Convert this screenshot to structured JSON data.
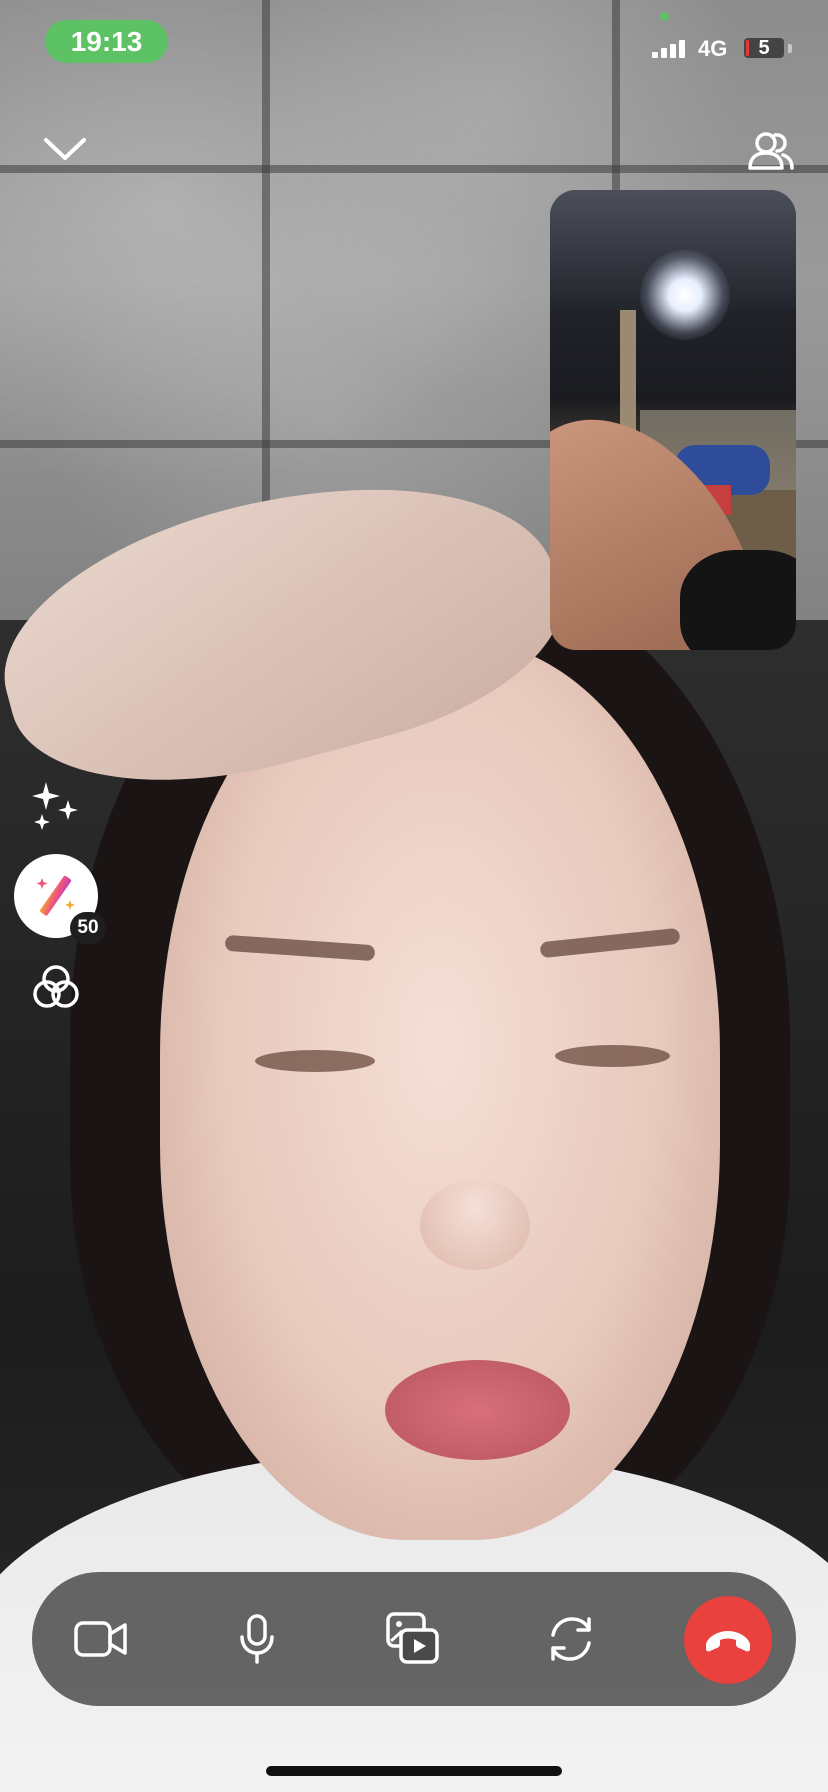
{
  "status_bar": {
    "time": "19:13",
    "network": "4G",
    "battery_level": "5",
    "signal_bars": 3,
    "colors": {
      "time_pill": "#5dc264",
      "battery_low": "#e53935"
    }
  },
  "top_controls": {
    "collapse_icon": "chevron-down-icon",
    "participants_icon": "participants-icon"
  },
  "side_tools": {
    "effects_icon": "sparkles-icon",
    "magic_wand_icon": "magic-wand-icon",
    "magic_wand_badge": "50",
    "filters_icon": "filters-icon"
  },
  "call_controls": {
    "items": [
      {
        "icon": "video-camera-icon"
      },
      {
        "icon": "microphone-icon"
      },
      {
        "icon": "media-share-icon"
      },
      {
        "icon": "switch-camera-icon"
      },
      {
        "icon": "end-call-icon"
      }
    ],
    "end_call_color": "#e8413e"
  }
}
